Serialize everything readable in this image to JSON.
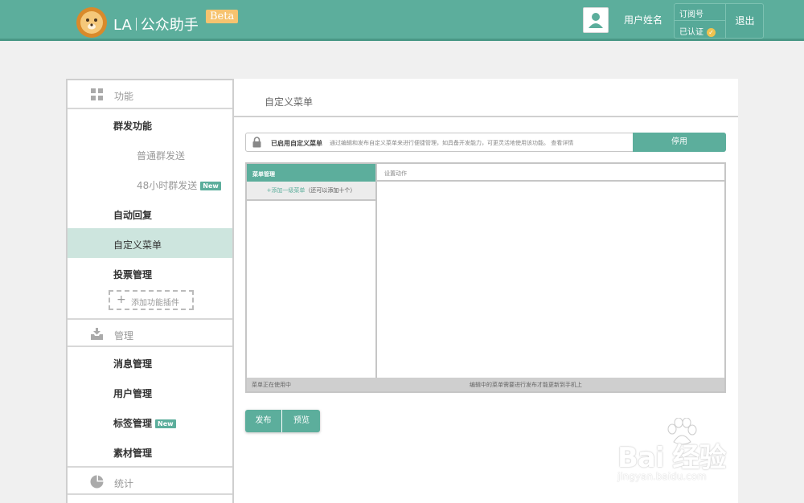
{
  "topbar": {
    "brand_prefix": "LA",
    "brand_name": "公众助手",
    "beta": "Beta",
    "user_name": "用户姓名",
    "account_type": "订阅号",
    "verified": "已认证",
    "logout": "退出"
  },
  "sidebar": {
    "sections": [
      {
        "title": "功能",
        "icon": "grid-icon"
      },
      {
        "title": "管理",
        "icon": "inbox-download-icon"
      },
      {
        "title": "统计",
        "icon": "pie-chart-icon"
      }
    ],
    "items": [
      {
        "label": "群发功能"
      },
      {
        "label": "普通群发送"
      },
      {
        "label": "48小时群发送",
        "badge": "New"
      },
      {
        "label": "自动回复"
      },
      {
        "label": "自定义菜单"
      },
      {
        "label": "投票管理"
      },
      {
        "label": "添加功能插件"
      },
      {
        "label": "消息管理"
      },
      {
        "label": "用户管理"
      },
      {
        "label": "标签管理",
        "badge": "New"
      },
      {
        "label": "素材管理"
      }
    ]
  },
  "main": {
    "title": "自定义菜单",
    "notice": {
      "bold": "已启用自定义菜单",
      "desc": "通过编辑和发布自定义菜单来进行便捷管理，如具备开发能力，可更灵活地使用该功能。 查看详情",
      "button": "停用"
    },
    "editor": {
      "menu_header": "菜单管理",
      "add_menu": "+添加一级菜单",
      "add_menu_hint": "（还可以添加十个）",
      "action_header": "设置动作",
      "status_left": "菜单正在使用中",
      "status_right": "编辑中的菜单需要进行发布才能更新到手机上"
    },
    "publish": "发布",
    "preview": "预览"
  },
  "watermark": {
    "brand": "Bai  经验",
    "url": "jingyan.baidu.com"
  },
  "colors": {
    "accent": "#5cae9c",
    "active_bg": "#cde5de",
    "beta": "#f6c36f"
  }
}
